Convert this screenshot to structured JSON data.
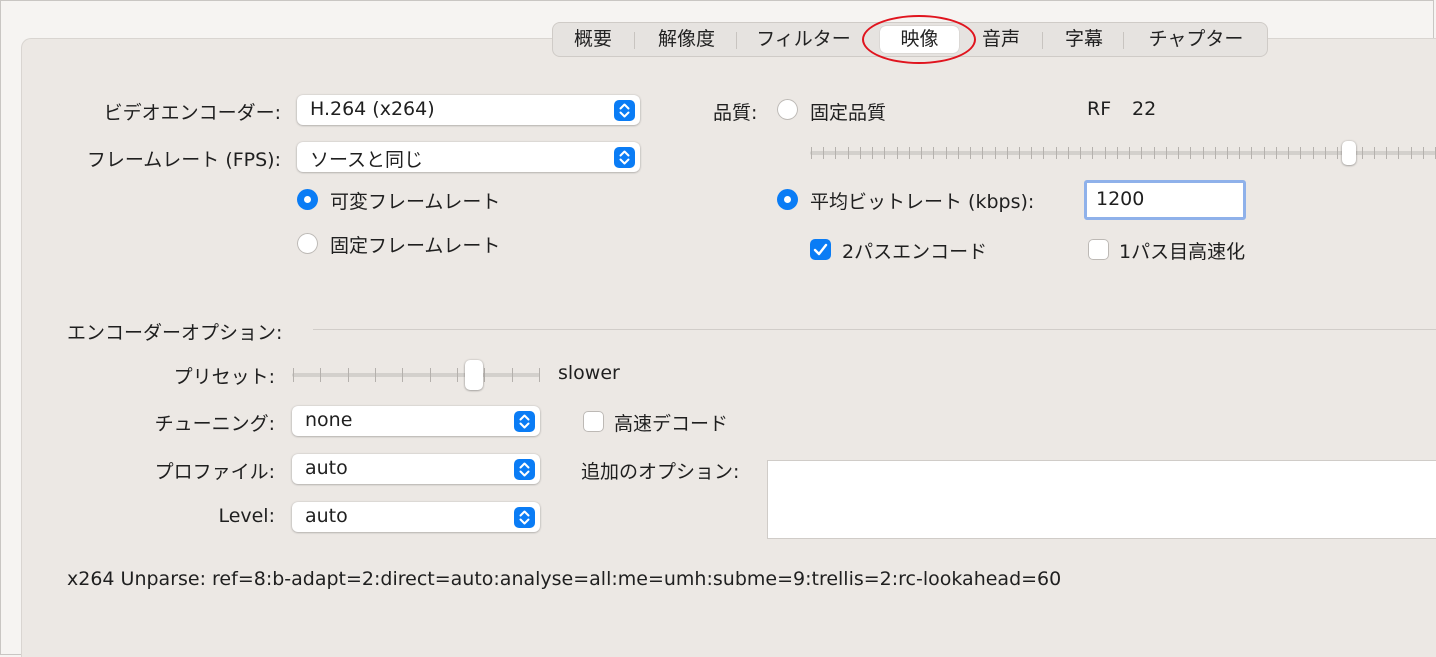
{
  "tabs": [
    {
      "label": "概要",
      "active": false
    },
    {
      "label": "解像度",
      "active": false
    },
    {
      "label": "フィルター",
      "active": false
    },
    {
      "label": "映像",
      "active": true
    },
    {
      "label": "音声",
      "active": false
    },
    {
      "label": "字幕",
      "active": false
    },
    {
      "label": "チャプター",
      "active": false
    }
  ],
  "video": {
    "encoder_label": "ビデオエンコーダー:",
    "encoder_value": "H.264 (x264)",
    "framerate_label": "フレームレート (FPS):",
    "framerate_value": "ソースと同じ",
    "variable_fr_label": "可変フレームレート",
    "constant_fr_label": "固定フレームレート",
    "variable_fr_selected": true
  },
  "quality": {
    "label": "品質:",
    "constant_quality_label": "固定品質",
    "rf_label": "RF",
    "rf_value": "22",
    "rf_slider_level": 0.87,
    "avg_bitrate_label": "平均ビットレート (kbps):",
    "avg_bitrate_value": "1200",
    "avg_bitrate_selected": true,
    "two_pass_label": "2パスエンコード",
    "two_pass_checked": true,
    "turbo_label": "1パス目高速化",
    "turbo_checked": false
  },
  "encoder_options": {
    "section_label": "エンコーダーオプション:",
    "preset_label": "プリセット:",
    "preset_value": "slower",
    "preset_level": 0.75,
    "tune_label": "チューニング:",
    "tune_value": "none",
    "fast_decode_label": "高速デコード",
    "fast_decode_checked": false,
    "profile_label": "プロファイル:",
    "profile_value": "auto",
    "extra_options_label": "追加のオプション:",
    "extra_options_value": "",
    "level_label": "Level:",
    "level_value": "auto"
  },
  "unparse": "x264 Unparse: ref=8:b-adapt=2:direct=auto:analyse=all:me=umh:subme=9:trellis=2:rc-lookahead=60",
  "colors": {
    "accent": "#0a7cf5",
    "highlight": "#e0141e"
  }
}
